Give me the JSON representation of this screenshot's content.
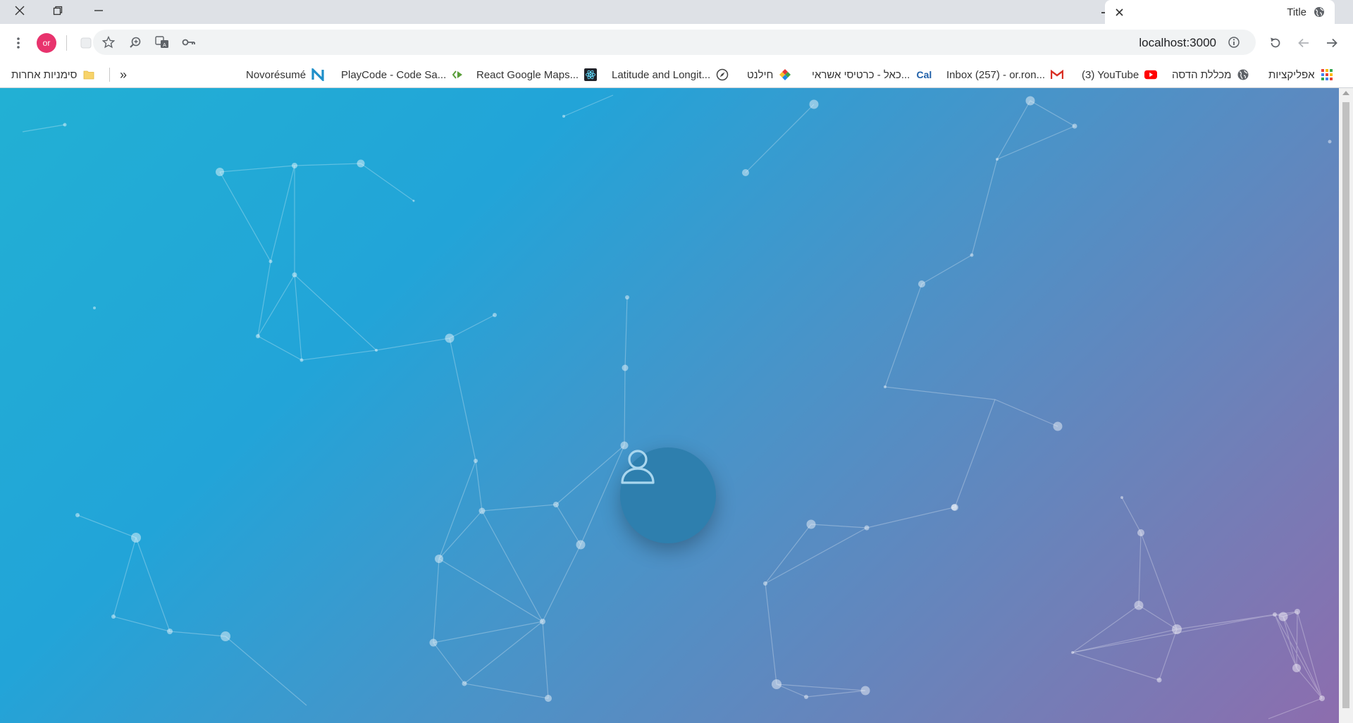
{
  "browser": {
    "tab": {
      "title": "Title"
    },
    "address_bar": {
      "url": "localhost:3000"
    },
    "profile": {
      "initials": "or",
      "color": "#e8336d"
    },
    "bookmarks": [
      {
        "label": "אפליקציות",
        "icon": "apps-grid-icon"
      },
      {
        "label": "מכללת הדסה",
        "icon": "globe-icon"
      },
      {
        "label": "(3) YouTube",
        "icon": "youtube-icon"
      },
      {
        "label": "Inbox (257) - or.ron...",
        "icon": "gmail-icon"
      },
      {
        "label": "כאל - כרטיסי אשראי...",
        "icon": "cal-icon",
        "icon_text": "Cal"
      },
      {
        "label": "חילנט",
        "icon": "hilnet-icon"
      },
      {
        "label": "Latitude and Longit...",
        "icon": "compass-icon"
      },
      {
        "label": "React Google Maps...",
        "icon": "react-icon"
      },
      {
        "label": "PlayCode - Code Sa...",
        "icon": "playcode-icon"
      },
      {
        "label": "Novorésumé",
        "icon": "novoresume-icon"
      }
    ],
    "other_bookmarks": {
      "label": "סימניות אחרות",
      "icon": "folder-icon"
    },
    "overflow_label": "»"
  },
  "page": {
    "background_gradient": [
      "#22b0d4",
      "#22a4d8",
      "#4a93c8",
      "#6f80b8",
      "#8d6dae"
    ],
    "login_avatar_icon": "user-icon"
  }
}
